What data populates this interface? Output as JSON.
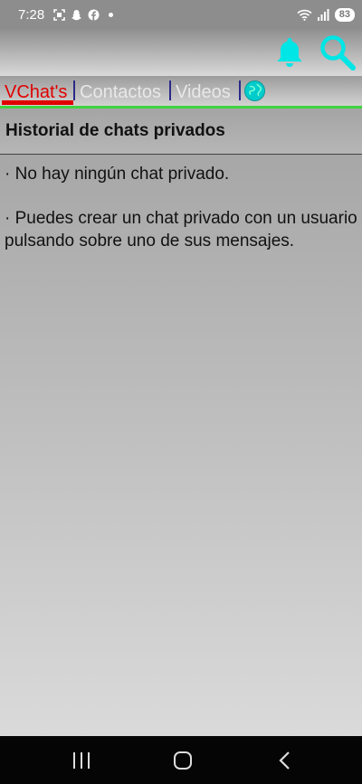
{
  "status": {
    "time": "7:28",
    "battery": "83"
  },
  "tabs": {
    "vchats": "VChat's",
    "contactos": "Contactos",
    "videos": "Videos"
  },
  "section": {
    "title": "Historial de chats privados"
  },
  "messages": {
    "no_chats": "· No hay ningún chat privado.",
    "hint": "· Puedes crear un chat privado con un usuario pulsando sobre uno de sus mensajes."
  },
  "colors": {
    "accent": "#e00000",
    "icon": "#00e5e5",
    "tab_border": "#3fd33f"
  },
  "icons": {
    "bell": "bell-icon",
    "search": "search-icon",
    "globe": "globe-icon"
  }
}
